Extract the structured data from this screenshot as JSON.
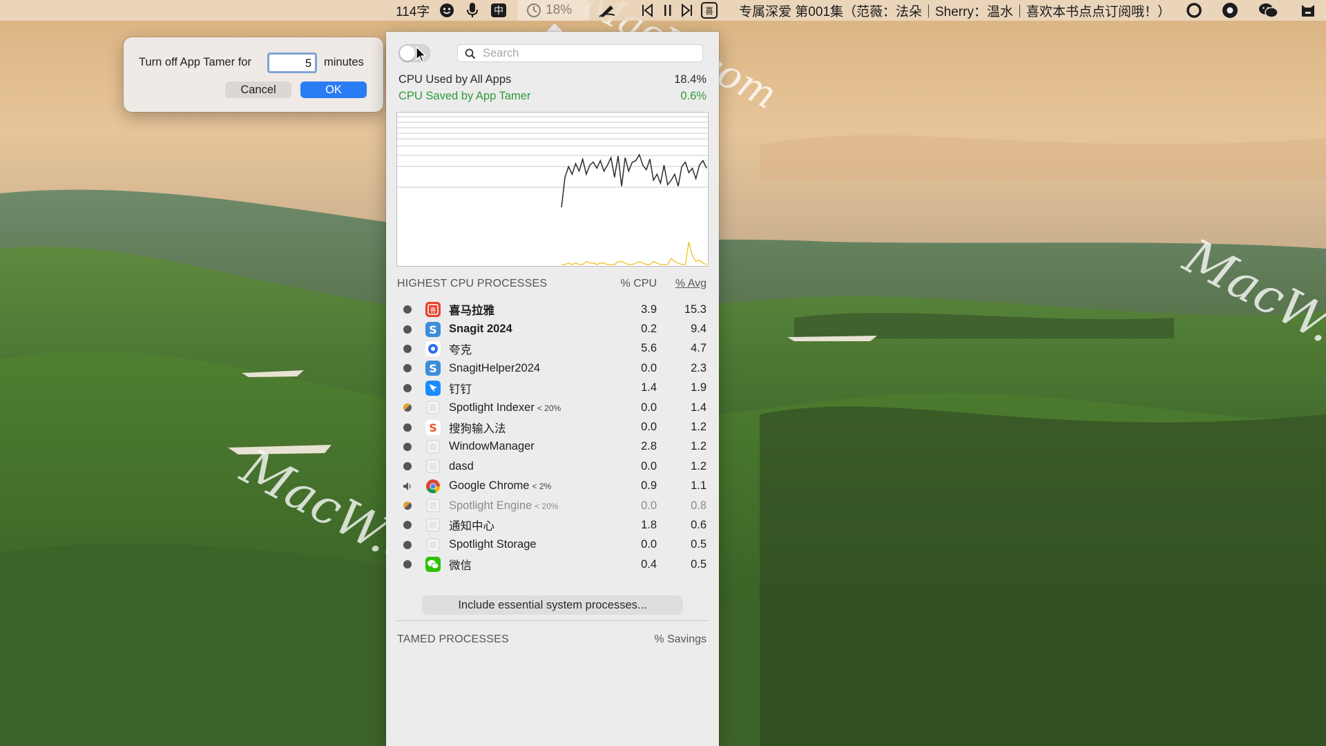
{
  "menubar": {
    "word_count": "114字",
    "cpu_percent": "18%",
    "now_playing": "专属深爱 第001集（范薇：法朵｜Sherry：温水｜喜欢本书点点订阅哦！）",
    "icons": [
      "smiley-icon",
      "microphone-icon",
      "input-method-icon",
      "app-tamer-icon",
      "pen-icon",
      "previous-track-icon",
      "pause-icon",
      "next-track-icon",
      "ximalaya-icon",
      "circle-status-icon",
      "record-icon",
      "wechat-icon",
      "cat-icon"
    ]
  },
  "watermark": {
    "text": "MacW.com"
  },
  "dialog": {
    "label_before": "Turn off App Tamer for",
    "minutes_value": "5",
    "label_after": "minutes",
    "cancel_label": "Cancel",
    "ok_label": "OK"
  },
  "panel": {
    "search_placeholder": "Search",
    "cpu_used_label": "CPU Used by All Apps",
    "cpu_used_value": "18.4%",
    "cpu_saved_label": "CPU Saved by App Tamer",
    "cpu_saved_value": "0.6%",
    "highest_header": "HIGHEST CPU PROCESSES",
    "col_cpu": "% CPU",
    "col_avg": "% Avg",
    "processes": [
      {
        "name": "喜马拉雅",
        "limit": "",
        "cpu": "3.9",
        "avg": "15.3",
        "icon": "ximalaya-icon",
        "status": "dot",
        "bold": true,
        "dim": false
      },
      {
        "name": "Snagit 2024",
        "limit": "",
        "cpu": "0.2",
        "avg": "9.4",
        "icon": "snagit-icon",
        "status": "dot",
        "bold": true,
        "dim": false
      },
      {
        "name": "夸克",
        "limit": "",
        "cpu": "5.6",
        "avg": "4.7",
        "icon": "quark-icon",
        "status": "dot",
        "bold": false,
        "dim": false
      },
      {
        "name": "SnagitHelper2024",
        "limit": "",
        "cpu": "0.0",
        "avg": "2.3",
        "icon": "snagit-icon",
        "status": "dot",
        "bold": false,
        "dim": false
      },
      {
        "name": "钉钉",
        "limit": "",
        "cpu": "1.4",
        "avg": "1.9",
        "icon": "dingtalk-icon",
        "status": "dot",
        "bold": false,
        "dim": false
      },
      {
        "name": "Spotlight Indexer",
        "limit": "< 20%",
        "cpu": "0.0",
        "avg": "1.4",
        "icon": "generic-app-icon",
        "status": "half",
        "bold": false,
        "dim": false
      },
      {
        "name": "搜狗输入法",
        "limit": "",
        "cpu": "0.0",
        "avg": "1.2",
        "icon": "sogou-icon",
        "status": "dot",
        "bold": false,
        "dim": false
      },
      {
        "name": "WindowManager",
        "limit": "",
        "cpu": "2.8",
        "avg": "1.2",
        "icon": "generic-app-icon",
        "status": "dot",
        "bold": false,
        "dim": false
      },
      {
        "name": "dasd",
        "limit": "",
        "cpu": "0.0",
        "avg": "1.2",
        "icon": "generic-app-icon",
        "status": "dot",
        "bold": false,
        "dim": false
      },
      {
        "name": "Google Chrome",
        "limit": "< 2%",
        "cpu": "0.9",
        "avg": "1.1",
        "icon": "chrome-icon",
        "status": "speaker",
        "bold": false,
        "dim": false
      },
      {
        "name": "Spotlight Engine",
        "limit": "< 20%",
        "cpu": "0.0",
        "avg": "0.8",
        "icon": "generic-app-icon",
        "status": "half",
        "bold": false,
        "dim": true
      },
      {
        "name": "通知中心",
        "limit": "",
        "cpu": "1.8",
        "avg": "0.6",
        "icon": "generic-app-icon",
        "status": "dot",
        "bold": false,
        "dim": false
      },
      {
        "name": "Spotlight Storage",
        "limit": "",
        "cpu": "0.0",
        "avg": "0.5",
        "icon": "generic-app-icon",
        "status": "dot",
        "bold": false,
        "dim": false
      },
      {
        "name": "微信",
        "limit": "",
        "cpu": "0.4",
        "avg": "0.5",
        "icon": "wechat-icon",
        "status": "dot",
        "bold": false,
        "dim": false
      }
    ],
    "essential_button": "Include essential system processes...",
    "tamed_header": "TAMED PROCESSES",
    "col_savings": "% Savings"
  },
  "chart_data": {
    "type": "line",
    "ylim": [
      0,
      100
    ],
    "grid": true,
    "series": [
      {
        "color": "#2b2b2b",
        "values": [
          38,
          58,
          65,
          60,
          67,
          62,
          70,
          60,
          66,
          68,
          64,
          69,
          62,
          66,
          71,
          58,
          72,
          52,
          71,
          62,
          68,
          69,
          73,
          66,
          63,
          70,
          56,
          60,
          54,
          66,
          53,
          56,
          60,
          52,
          65,
          68,
          61,
          64,
          57,
          66,
          69,
          64
        ]
      },
      {
        "color": "#f0c020",
        "values": [
          0,
          0,
          1,
          0,
          1,
          0,
          0,
          2,
          1,
          1,
          0,
          1,
          1,
          0,
          0,
          0,
          2,
          2,
          1,
          0,
          0,
          1,
          2,
          1,
          0,
          0,
          2,
          1,
          0,
          0,
          0,
          4,
          2,
          1,
          0,
          0,
          15,
          6,
          2,
          3,
          1,
          0
        ]
      }
    ],
    "accent": {
      "ok": "#2a7cf5",
      "saved": "#2d9a3a",
      "dialog_focus": "#7ea2d8"
    }
  }
}
